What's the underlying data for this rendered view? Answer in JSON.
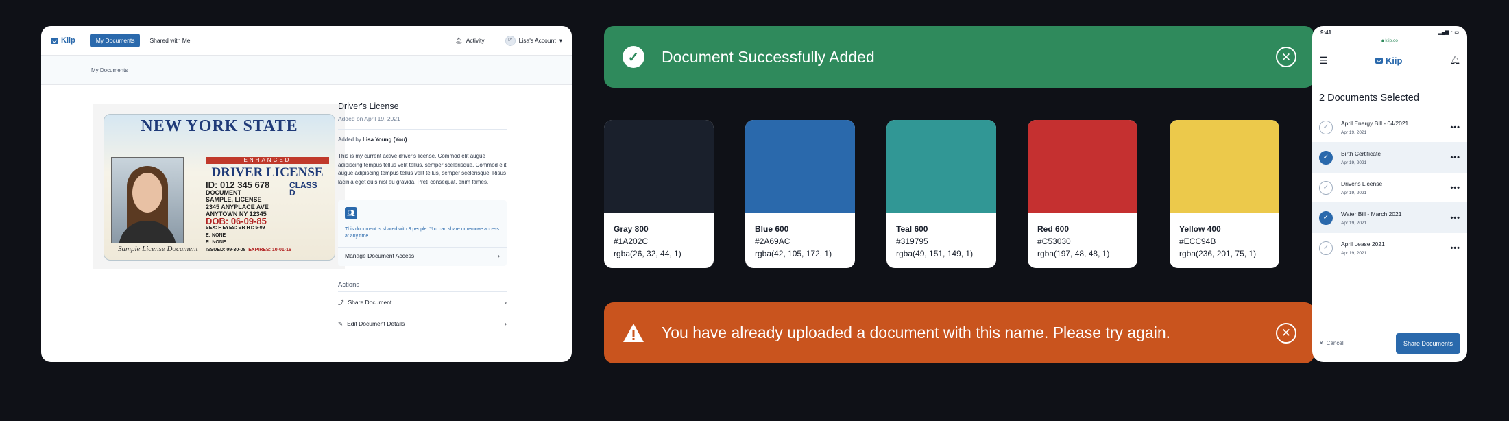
{
  "desktop": {
    "logo": "Kiip",
    "nav": {
      "my_documents": "My Documents",
      "shared": "Shared with Me",
      "activity": "Activity",
      "account": "Lisa's Account"
    },
    "breadcrumb": "My Documents",
    "id_card": {
      "state": "NEW YORK STATE",
      "enhanced": "ENHANCED",
      "title": "DRIVER LICENSE",
      "id_line": "ID: 012 345 678",
      "class": "CLASS D",
      "name1": "DOCUMENT",
      "name2": "SAMPLE, LICENSE",
      "addr1": "2345 ANYPLACE AVE",
      "addr2": "ANYTOWN NY 12345",
      "dob": "DOB: 06-09-85",
      "details": "SEX: F  EYES: BR  HT: 5-09",
      "e": "E: NONE",
      "r": "R: NONE",
      "issued": "ISSUED: 09-30-08",
      "expires": "EXPIRES: 10-01-16",
      "signature": "Sample License Document"
    },
    "detail": {
      "title": "Driver's License",
      "added_on": "Added on April 19, 2021",
      "added_by_prefix": "Added by",
      "added_by_name": "Lisa Young (You)",
      "description": "This is my current active driver's license. Commod elit augue adipiscing tempus tellus velit tellus, semper scelerisque. Commod elit augue adipiscing tempus tellus velit tellus, semper scelerisque. Risus lacinia eget quis nisl eu gravida. Preti consequat, enim fames.",
      "share_note": "This document is shared with 3 people. You can share or remove access at any time.",
      "manage": "Manage Document Access",
      "actions_title": "Actions",
      "share_doc": "Share Document",
      "edit_doc": "Edit Document Details"
    }
  },
  "banners": {
    "success": "Document Successfully Added",
    "warning": "You have already uploaded a document with this name. Please try again.",
    "success_color": "#2F8A5C",
    "warning_color": "#C9541E"
  },
  "swatches": [
    {
      "name": "Gray 800",
      "hex": "#1A202C",
      "rgba": "rgba(26, 32, 44, 1)"
    },
    {
      "name": "Blue 600",
      "hex": "#2A69AC",
      "rgba": "rgba(42, 105, 172, 1)"
    },
    {
      "name": "Teal 600",
      "hex": "#319795",
      "rgba": "rgba(49, 151, 149, 1)"
    },
    {
      "name": "Red 600",
      "hex": "#C53030",
      "rgba": "rgba(197, 48, 48, 1)"
    },
    {
      "name": "Yellow 400",
      "hex": "#ECC94B",
      "rgba": "rgba(236, 201, 75, 1)"
    }
  ],
  "mobile": {
    "time": "9:41",
    "url": "kiip.co",
    "logo": "Kiip",
    "title": "2 Documents Selected",
    "items": [
      {
        "name": "April Energy Bill - 04/2021",
        "date": "Apr 19, 2021",
        "selected": false
      },
      {
        "name": "Birth Certificate",
        "date": "Apr 19, 2021",
        "selected": true
      },
      {
        "name": "Driver's License",
        "date": "Apr 19, 2021",
        "selected": false
      },
      {
        "name": "Water Bill - March 2021",
        "date": "Apr 19, 2021",
        "selected": true
      },
      {
        "name": "April Lease 2021",
        "date": "Apr 19, 2021",
        "selected": false
      }
    ],
    "cancel": "Cancel",
    "share": "Share Documents"
  }
}
